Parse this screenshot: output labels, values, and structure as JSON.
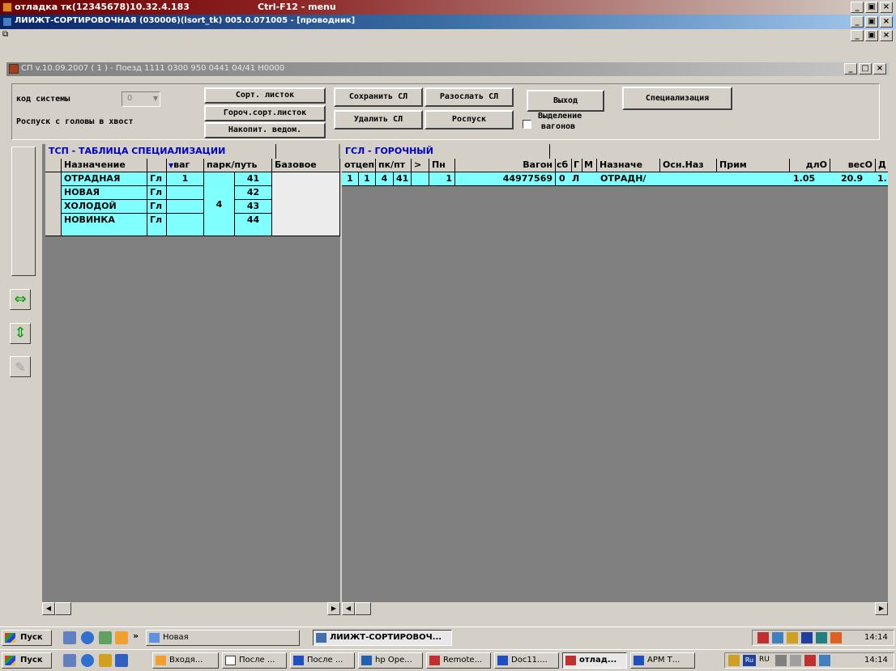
{
  "window1": {
    "title": "отладка тк(12345678)10.32.4.183",
    "shortcut": "Ctrl-F12 - menu"
  },
  "window2": {
    "title": "ЛИИЖТ-СОРТИРОВОЧНАЯ (030006)(lsort_tk) 005.0.071005 - [проводник]"
  },
  "window3": {
    "title": "СП v.10.09.2007 ( 1 ) - Поезд 1111  0300 950 0441  04/41  Н0000"
  },
  "win_buttons": {
    "min": "_",
    "max": "□",
    "restore": "🗗",
    "close": "×"
  },
  "toolbar": {
    "system_code_label": "код  системы",
    "system_code_value": "0",
    "rospusk_label": "Роспуск с головы в хвост",
    "sort_list": "Сорт. листок",
    "gorochn_sort_list": "Гороч.сорт.листок",
    "nakopit": "Накопит. ведом.",
    "save_sl": "Сохранить СЛ",
    "send_sl": "Разослать СЛ",
    "delete_sl": "Удалить  СЛ",
    "rospusk": "Роспуск",
    "exit": "Выход",
    "specialization": "Специализация",
    "select_wagons_line1": "Выделение",
    "select_wagons_line2": "вагонов"
  },
  "tsp": {
    "title": "ТСП - ТАБЛИЦА СПЕЦИАЛИЗАЦИИ",
    "headers": {
      "dest": "Назначение",
      "type": "",
      "vag": "ваг",
      "park": "парк/путь",
      "base": "Базовое"
    },
    "park_value": "4",
    "vag_value": "1",
    "rows": [
      {
        "dest": "ОТРАДНАЯ",
        "type": "Гл",
        "track": "41"
      },
      {
        "dest": "НОВАЯ",
        "type": "Гл",
        "track": "42"
      },
      {
        "dest": "ХОЛОДОЙ",
        "type": "Гл",
        "track": "43"
      },
      {
        "dest": "НОВИНКА",
        "type": "Гл",
        "track": "44"
      }
    ]
  },
  "gsl": {
    "title": "ГСЛ - ГОРОЧНЫЙ",
    "headers": {
      "otsep": "отцеп",
      "pk": "пк/пт",
      "gt": ">",
      "pn": "Пн",
      "wagon": "Вагон",
      "sb": "сб",
      "g": "Г",
      "m": "М",
      "dest": "Назначе",
      "osn": "Осн.Наз",
      "prim": "Прим",
      "dlo": "длО",
      "veso": "весО",
      "extra": "Д"
    },
    "row": {
      "otsep": "1",
      "o2": "1",
      "pk": "4",
      "pt": "41",
      "pn": "1",
      "wagon": "44977569",
      "sb": "0",
      "g": "Л",
      "dest": "ОТРАДН/",
      "dlo": "1.05",
      "veso": "20.9",
      "extra": "1."
    }
  },
  "taskbar1": {
    "start": "Пуск",
    "new_folder": "Новая",
    "active": "ЛИИЖТ-СОРТИРОВОЧ...",
    "clock": "14:14"
  },
  "taskbar2": {
    "start": "Пуск",
    "items": [
      "Входя...",
      "После ...",
      "После ...",
      "hp Ope...",
      "Remote...",
      "Doc11....",
      "отлад...",
      "АРМ Т..."
    ],
    "lang": "RU",
    "clock": "14:14"
  }
}
